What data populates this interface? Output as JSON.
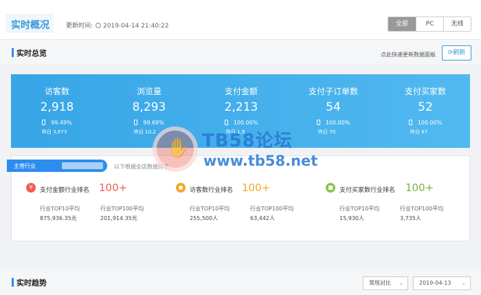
{
  "header": {
    "title": "实时概况",
    "update_label": "更新时间:",
    "update_time": "2019-04-14 21:40:22",
    "tabs": [
      "全部",
      "PC",
      "无线"
    ]
  },
  "overview": {
    "section_title": "实时总览",
    "hint": "点此快速更新数据面板",
    "refresh_label": "刷新",
    "metrics": [
      {
        "label": "访客数",
        "value": "2,918",
        "pct": "99.49%",
        "yesterday_label": "昨日",
        "yesterday": "3,673"
      },
      {
        "label": "浏览量",
        "value": "8,293",
        "pct": "99.69%",
        "yesterday_label": "昨日",
        "yesterday": "10,2"
      },
      {
        "label": "支付金额",
        "value": "2,213",
        "pct": "100.00%",
        "yesterday_label": "昨日",
        "yesterday": "1,9"
      },
      {
        "label": "支付子订单数",
        "value": "54",
        "pct": "100.00%",
        "yesterday_label": "昨日",
        "yesterday": "70"
      },
      {
        "label": "支付买家数",
        "value": "52",
        "pct": "100.00%",
        "yesterday_label": "昨日",
        "yesterday": "67"
      }
    ]
  },
  "industry": {
    "tag": "主营行业",
    "hint": "以下根据全店数据排名",
    "ranks": [
      {
        "icon": "¥",
        "icon_color": "#f25c54",
        "label": "支付金额行业排名",
        "value": "100+",
        "value_color": "#f25c54",
        "top10_label": "行业TOP10平均",
        "top10": "875,936.35元",
        "top100_label": "行业TOP100平均",
        "top100": "201,914.35元"
      },
      {
        "icon": "●",
        "icon_color": "#f5a623",
        "label": "访客数行业排名",
        "value": "100+",
        "value_color": "#f5a623",
        "top10_label": "行业TOP10平均",
        "top10": "255,500人",
        "top100_label": "行业TOP100平均",
        "top100": "63,442人"
      },
      {
        "icon": "■",
        "icon_color": "#8bc34a",
        "label": "支付买家数行业排名",
        "value": "100+",
        "value_color": "#7cb342",
        "top10_label": "行业TOP10平均",
        "top10": "15,930人",
        "top100_label": "行业TOP100平均",
        "top100": "3,735人"
      }
    ]
  },
  "trend": {
    "section_title": "实时趋势",
    "compare_label": "常规对比",
    "date": "2019-04-13"
  },
  "watermark": {
    "line1": "TB58论坛",
    "line2": "www.tb58.net"
  }
}
